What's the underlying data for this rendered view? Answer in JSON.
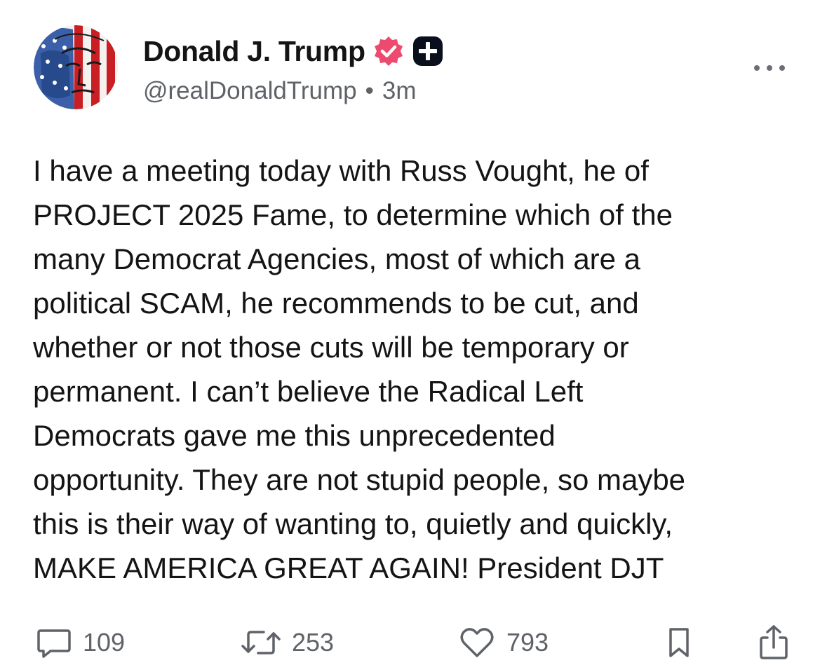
{
  "post": {
    "author": {
      "display_name": "Donald J. Trump",
      "handle": "@realDonaldTrump",
      "time": "3m",
      "separator": "•",
      "avatar_icon": "flag-portrait-avatar",
      "verified_icon": "verified-badge-icon",
      "verified_color": "#ec4b6f",
      "plus_icon": "plus-badge-icon"
    },
    "text": "I have a meeting today with Russ Vought, he of\nPROJECT 2025 Fame, to determine which of the\nmany Democrat Agencies, most of which are a\npolitical SCAM, he recommends to be cut, and\nwhether or not those cuts will be temporary or\npermanent. I can’t believe the Radical Left\nDemocrats gave me this unprecedented\nopportunity. They are not stupid people, so maybe\nthis is their way of wanting to, quietly and quickly,\nMAKE AMERICA GREAT AGAIN! President DJT",
    "actions": {
      "replies": "109",
      "reposts": "253",
      "likes": "793"
    },
    "icons": {
      "more": "more-options-icon",
      "reply": "comment-icon",
      "repost": "repost-icon",
      "like": "heart-icon",
      "bookmark": "bookmark-icon",
      "share": "share-icon"
    }
  }
}
